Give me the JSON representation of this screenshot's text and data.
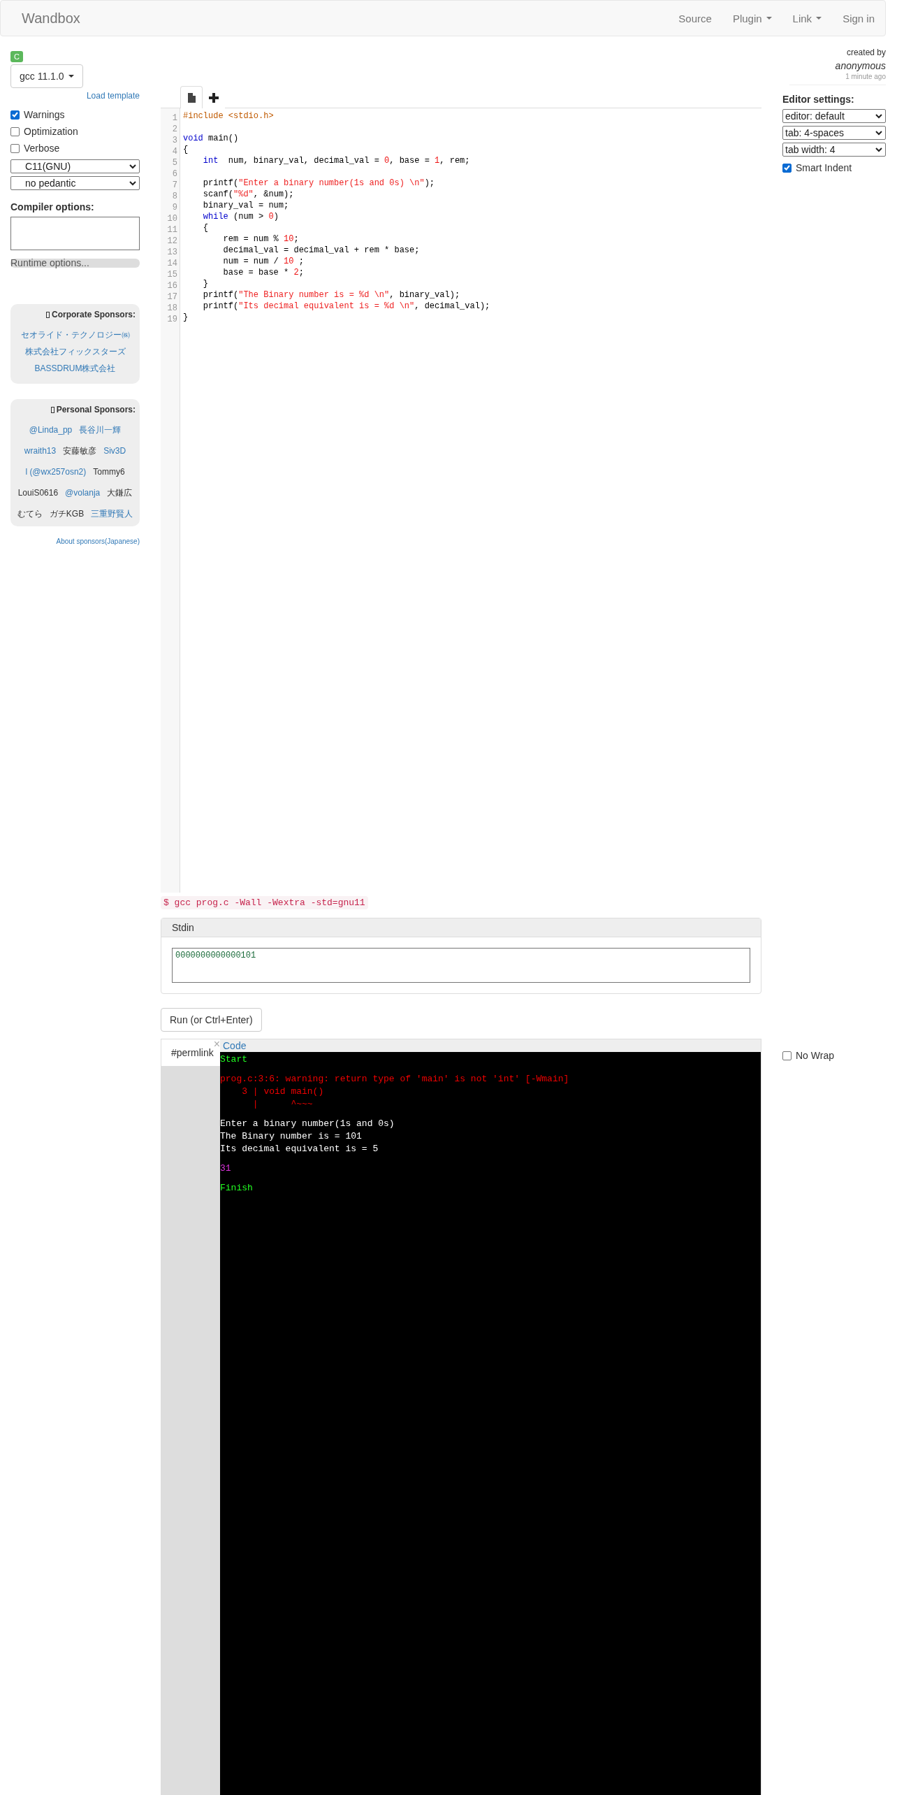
{
  "navbar": {
    "brand": "Wandbox",
    "links": [
      {
        "label": "Source",
        "dropdown": false
      },
      {
        "label": "Plugin",
        "dropdown": true
      },
      {
        "label": "Link",
        "dropdown": true
      },
      {
        "label": "Sign in",
        "dropdown": false
      }
    ]
  },
  "compiler": {
    "language_badge": "C",
    "version": "gcc 11.1.0",
    "load_template": "Load template",
    "options": [
      {
        "label": "Warnings",
        "checked": true
      },
      {
        "label": "Optimization",
        "checked": false
      },
      {
        "label": "Verbose",
        "checked": false
      }
    ],
    "selects": [
      "C11(GNU)",
      "no pedantic"
    ],
    "compiler_options_label": "Compiler options:",
    "runtime_options": "Runtime options..."
  },
  "corporate_sponsors": {
    "title": "Corporate Sponsors:",
    "names": [
      "セオライド・テクノロジー㈱",
      "株式会社フィックスターズ",
      "BASSDRUM株式会社"
    ]
  },
  "personal_sponsors": {
    "title": "Personal Sponsors:",
    "names": [
      {
        "name": "@Linda_pp",
        "linked": true
      },
      {
        "name": "長谷川一輝",
        "linked": true
      },
      {
        "name": "wraith13",
        "linked": true
      },
      {
        "name": "安藤敏彦",
        "linked": false
      },
      {
        "name": "Siv3D",
        "linked": true
      },
      {
        "name": "l (@wx257osn2)",
        "linked": true
      },
      {
        "name": "Tommy6",
        "linked": false
      },
      {
        "name": "LouiS0616",
        "linked": false
      },
      {
        "name": "@volanja",
        "linked": true
      },
      {
        "name": "大鎌広",
        "linked": false
      },
      {
        "name": "むてら",
        "linked": false
      },
      {
        "name": "ガチKGB",
        "linked": false
      },
      {
        "name": "三重野賢人",
        "linked": true
      }
    ]
  },
  "about_sponsors": "About sponsors(Japanese)",
  "editor": {
    "lines": [
      {
        "number": "1",
        "tokens": [
          {
            "text": "#include <stdio.h>",
            "kind": "meta"
          }
        ]
      },
      {
        "number": "2"
      },
      {
        "number": "3",
        "tokens": [
          {
            "text": "void",
            "kind": "keyword"
          },
          {
            "text": " main()",
            "kind": "plain"
          }
        ]
      },
      {
        "number": "4",
        "tokens": [
          {
            "text": "{",
            "kind": "plain"
          }
        ]
      },
      {
        "number": "5",
        "tokens": [
          {
            "text": "    int",
            "kind": "keyword"
          },
          {
            "text": "  num, binary_val, decimal_val = ",
            "kind": "plain"
          },
          {
            "text": "0",
            "kind": "number"
          },
          {
            "text": ", base = ",
            "kind": "plain"
          },
          {
            "text": "1",
            "kind": "number"
          },
          {
            "text": ", rem;",
            "kind": "plain"
          }
        ]
      },
      {
        "number": "6"
      },
      {
        "number": "7",
        "tokens": [
          {
            "text": "    printf(",
            "kind": "plain"
          },
          {
            "text": "\"Enter a binary number(1s and 0s) \\n\"",
            "kind": "string"
          },
          {
            "text": ");",
            "kind": "plain"
          }
        ]
      },
      {
        "number": "8",
        "tokens": [
          {
            "text": "    scanf(",
            "kind": "plain"
          },
          {
            "text": "\"%d\"",
            "kind": "string"
          },
          {
            "text": ", &num);",
            "kind": "plain"
          }
        ]
      },
      {
        "number": "9",
        "tokens": [
          {
            "text": "    binary_val = num;",
            "kind": "plain"
          }
        ]
      },
      {
        "number": "10",
        "tokens": [
          {
            "text": "    while",
            "kind": "keyword"
          },
          {
            "text": " (num > ",
            "kind": "plain"
          },
          {
            "text": "0",
            "kind": "number"
          },
          {
            "text": ")",
            "kind": "plain"
          }
        ]
      },
      {
        "number": "11",
        "tokens": [
          {
            "text": "    {",
            "kind": "plain"
          }
        ]
      },
      {
        "number": "12",
        "tokens": [
          {
            "text": "        rem = num % ",
            "kind": "plain"
          },
          {
            "text": "10",
            "kind": "number"
          },
          {
            "text": ";",
            "kind": "plain"
          }
        ]
      },
      {
        "number": "13",
        "tokens": [
          {
            "text": "        decimal_val = decimal_val + rem * base;",
            "kind": "plain"
          }
        ]
      },
      {
        "number": "14",
        "tokens": [
          {
            "text": "        num = num / ",
            "kind": "plain"
          },
          {
            "text": "10",
            "kind": "number"
          },
          {
            "text": " ;",
            "kind": "plain"
          }
        ]
      },
      {
        "number": "15",
        "tokens": [
          {
            "text": "        base = base * ",
            "kind": "plain"
          },
          {
            "text": "2",
            "kind": "number"
          },
          {
            "text": ";",
            "kind": "plain"
          }
        ]
      },
      {
        "number": "16",
        "tokens": [
          {
            "text": "    }",
            "kind": "plain"
          }
        ]
      },
      {
        "number": "17",
        "tokens": [
          {
            "text": "    printf(",
            "kind": "plain"
          },
          {
            "text": "\"The Binary number is = %d \\n\"",
            "kind": "string"
          },
          {
            "text": ", binary_val);",
            "kind": "plain"
          }
        ]
      },
      {
        "number": "18",
        "tokens": [
          {
            "text": "    printf(",
            "kind": "plain"
          },
          {
            "text": "\"Its decimal equivalent is = %d \\n\"",
            "kind": "string"
          },
          {
            "text": ", decimal_val);",
            "kind": "plain"
          }
        ]
      },
      {
        "number": "19",
        "tokens": [
          {
            "text": "}",
            "kind": "plain"
          }
        ]
      }
    ]
  },
  "command_line": "$ gcc prog.c -Wall -Wextra -std=gnu11",
  "stdin": {
    "title": "Stdin",
    "value": "0000000000000101"
  },
  "run_button": "Run (or Ctrl+Enter)",
  "output": {
    "permlink_tab": "#permlink",
    "close": "×",
    "code_tab": "Code",
    "blocks": [
      {
        "kind": "start",
        "lines": [
          "Start"
        ]
      },
      {
        "kind": "compiler_message",
        "lines": [
          "prog.c:3:6: warning: return type of 'main' is not 'int' [-Wmain]",
          "    3 | void main()",
          "      |      ^~~~"
        ]
      },
      {
        "kind": "stdout",
        "lines": [
          "Enter a binary number(1s and 0s)",
          "The Binary number is = 101",
          "Its decimal equivalent is = 5"
        ]
      },
      {
        "kind": "exit_code",
        "lines": [
          "31"
        ]
      },
      {
        "kind": "finish",
        "lines": [
          "Finish"
        ]
      }
    ]
  },
  "author": {
    "created_by": "created by",
    "name": "anonymous",
    "time": "1 minute ago"
  },
  "editor_settings": {
    "title": "Editor settings:",
    "selects": [
      "editor: default",
      "tab: 4-spaces",
      "tab width: 4"
    ],
    "smart_indent": {
      "label": "Smart Indent",
      "checked": true
    }
  },
  "no_wrap": {
    "label": "No Wrap",
    "checked": false
  }
}
